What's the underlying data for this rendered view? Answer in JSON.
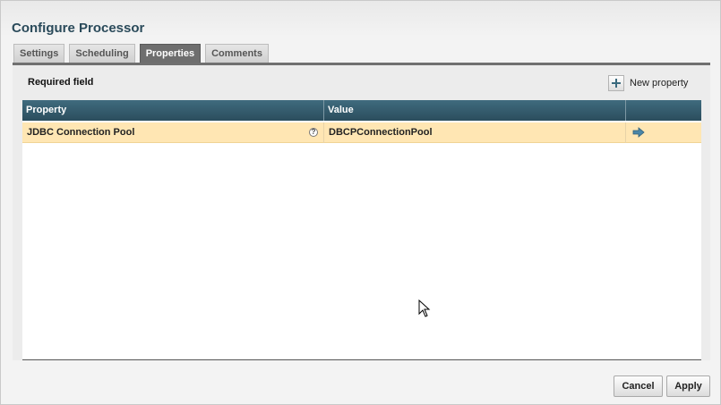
{
  "dialog": {
    "title": "Configure Processor"
  },
  "tabs": [
    {
      "label": "Settings",
      "active": false
    },
    {
      "label": "Scheduling",
      "active": false
    },
    {
      "label": "Properties",
      "active": true
    },
    {
      "label": "Comments",
      "active": false
    }
  ],
  "properties": {
    "required_label": "Required field",
    "new_property_label": "New property",
    "columns": [
      "Property",
      "Value",
      ""
    ],
    "rows": [
      {
        "property": "JDBC Connection Pool",
        "value": "DBCPConnectionPool",
        "help_icon": "question-circle-icon",
        "action_icon": "arrow-right-icon"
      }
    ]
  },
  "footer": {
    "cancel_label": "Cancel",
    "apply_label": "Apply"
  },
  "colors": {
    "header_bg": "#2b4d5d",
    "selected_row": "#ffe6b3",
    "active_tab": "#6e6e6e"
  }
}
